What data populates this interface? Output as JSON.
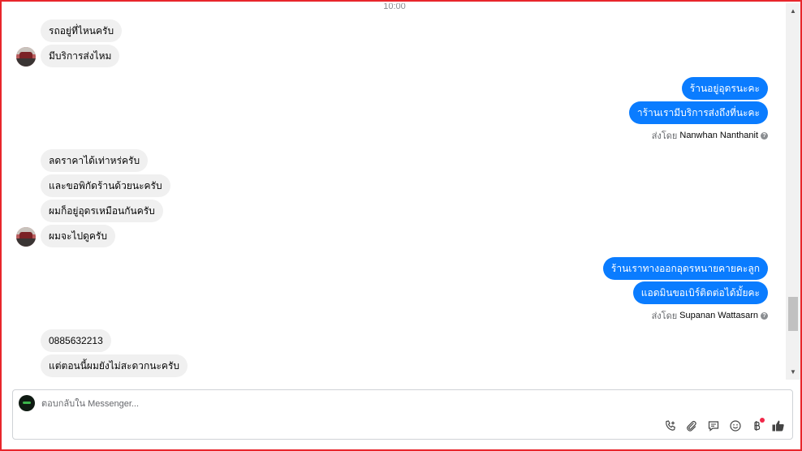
{
  "thread": {
    "timestamp": "10:00",
    "messages": [
      {
        "dir": "in",
        "text": "รถอยู่ที่ไหนครับ"
      },
      {
        "dir": "in",
        "text": "มีบริการส่งไหม"
      },
      {
        "dir": "out",
        "text": "ร้านอยู่อุดรนะคะ"
      },
      {
        "dir": "out",
        "text": "าร้านเรามีบริการส่งถึงที่นะคะ"
      },
      {
        "dir": "in",
        "text": "ลดราคาได้เท่าหร่ครับ"
      },
      {
        "dir": "in",
        "text": "และขอพิกัดร้านด้วยนะครับ"
      },
      {
        "dir": "in",
        "text": "ผมก็อยู่อุดรเหมือนกันครับ"
      },
      {
        "dir": "in",
        "text": "ผมจะไปดูครับ"
      },
      {
        "dir": "out",
        "text": "ร้านเราทางออกอุดรหนายคายคะลูก"
      },
      {
        "dir": "out",
        "text": "แอดมินขอเบิร์ติดต่อได้มั้ยคะ"
      },
      {
        "dir": "in",
        "text": "0885632213"
      },
      {
        "dir": "in",
        "text": "แต่ตอนนี้ผมยังไม่สะดวกนะครับ"
      }
    ],
    "sent_by": [
      {
        "prefix": "ส่งโดย",
        "name": "Nanwhan Nanthanit",
        "help_glyph": "?"
      },
      {
        "prefix": "ส่งโดย",
        "name": "Supanan Wattasarn",
        "help_glyph": "?"
      }
    ]
  },
  "scrollbar": {
    "up_glyph": "▲",
    "down_glyph": "▼",
    "position": 0.86
  },
  "composer": {
    "placeholder": "ตอบกลับใน Messenger...",
    "tools": [
      "add-call-icon",
      "attachment-icon",
      "saved-replies-icon",
      "emoji-icon",
      "payment-icon",
      "like-icon"
    ],
    "payment_has_notification": true
  },
  "colors": {
    "outgoing": "#0a7cff",
    "incoming": "#f0f0f0",
    "frame": "#e8262b",
    "notification": "#f02849"
  }
}
